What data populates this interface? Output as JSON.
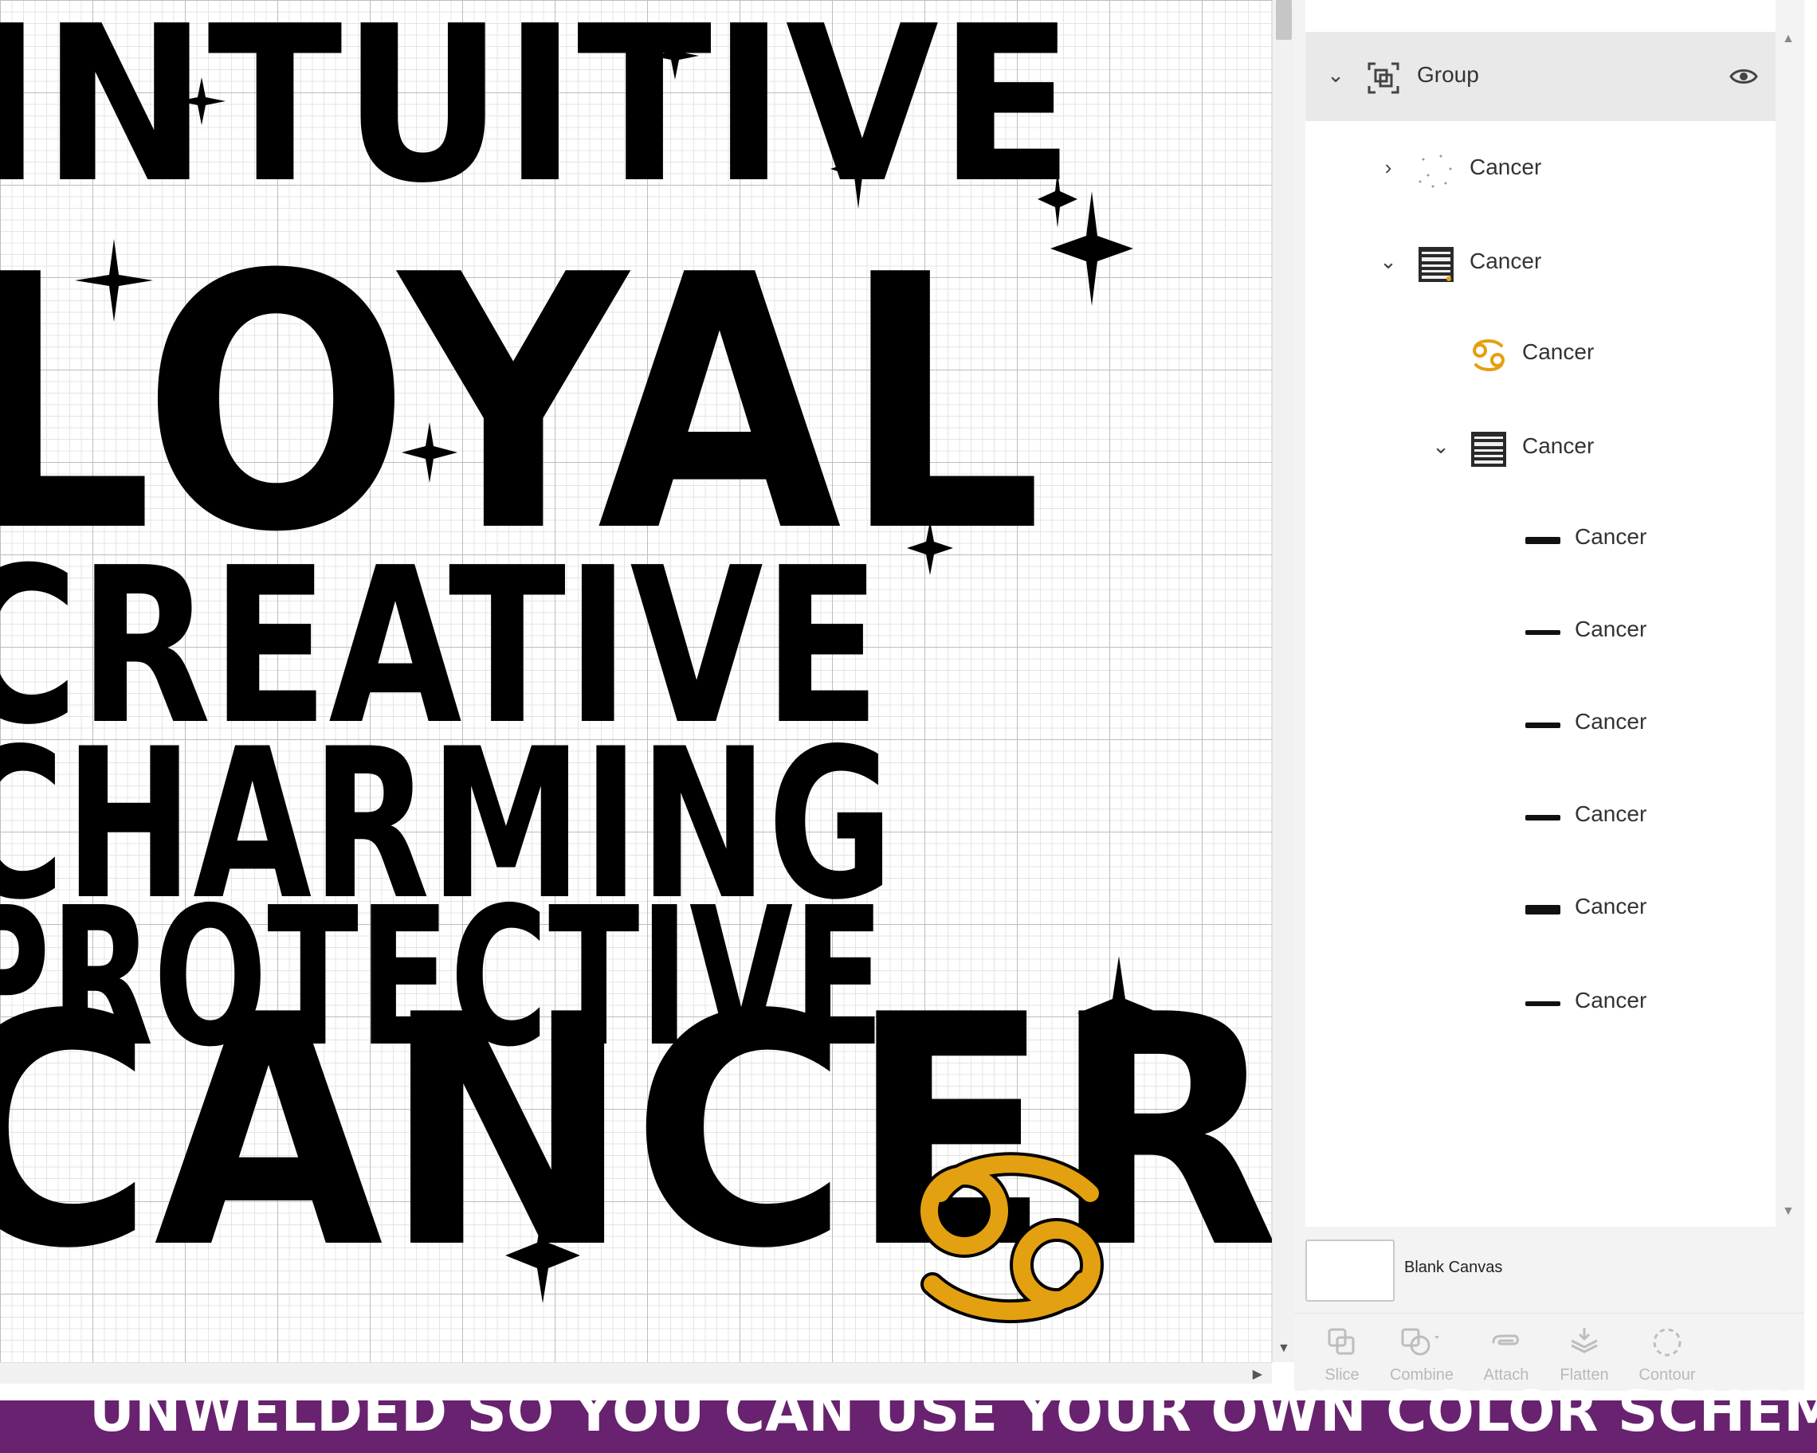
{
  "canvas": {
    "artwork_words": [
      "INTUITIVE",
      "LOYAL",
      "CREATIVE",
      "CHARMING",
      "PROTECTIVE",
      "CANCER"
    ],
    "cancer_symbol_color": "#e3a010",
    "artwork_color": "#000000"
  },
  "layers_panel": {
    "group": {
      "label": "Group",
      "expanded": true,
      "selected": true,
      "visible": true
    },
    "items": [
      {
        "label": "Cancer",
        "indent": 1,
        "caret": "right",
        "thumbnail": "sparkles-thumbnail"
      },
      {
        "label": "Cancer",
        "indent": 1,
        "caret": "down",
        "thumbnail": "design-thumbnail"
      },
      {
        "label": "Cancer",
        "indent": 2,
        "caret": "none",
        "thumbnail": "cancer-symbol-thumbnail"
      },
      {
        "label": "Cancer",
        "indent": 2,
        "caret": "down",
        "thumbnail": "design-thumbnail"
      },
      {
        "label": "Cancer",
        "indent": 3,
        "caret": "none",
        "thumbnail": "word-cancer-thumbnail"
      },
      {
        "label": "Cancer",
        "indent": 3,
        "caret": "none",
        "thumbnail": "word-intuitive-thumbnail"
      },
      {
        "label": "Cancer",
        "indent": 3,
        "caret": "none",
        "thumbnail": "word-charming-thumbnail"
      },
      {
        "label": "Cancer",
        "indent": 3,
        "caret": "none",
        "thumbnail": "word-creative-thumbnail"
      },
      {
        "label": "Cancer",
        "indent": 3,
        "caret": "none",
        "thumbnail": "word-loyal-thumbnail"
      },
      {
        "label": "Cancer",
        "indent": 3,
        "caret": "none",
        "thumbnail": "word-protective-thumbnail"
      }
    ],
    "canvas_label": "Blank Canvas"
  },
  "toolbar": {
    "slice": "Slice",
    "combine": "Combine",
    "attach": "Attach",
    "flatten": "Flatten",
    "contour": "Contour"
  },
  "banner": {
    "text": "UNWELDED SO YOU CAN USE YOUR OWN COLOR SCHEME",
    "background": "#68226f"
  }
}
